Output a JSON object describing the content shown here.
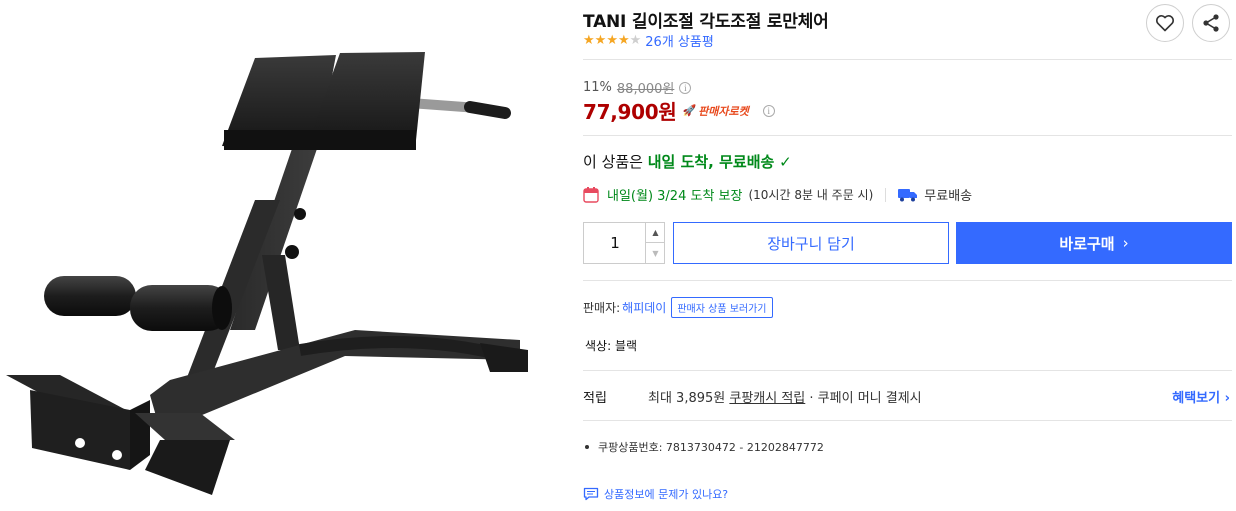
{
  "product": {
    "title": "TANI 길이조절 각도조절 로만체어",
    "rating_stars": 4,
    "rating_max": 5,
    "review_count": "26개 상품평"
  },
  "actions": {
    "wishlist_icon": "heart-outline-icon",
    "share_icon": "share-icon"
  },
  "price": {
    "discount_rate": "11%",
    "original_price": "88,000원",
    "sale_price": "77,900원",
    "badge": "판매자로켓"
  },
  "delivery": {
    "headline_prefix": "이 상품은 ",
    "headline_highlight": "내일 도착, 무료배송",
    "arrival": "내일(월) 3/24 도착 보장",
    "arrival_note": "(10시간 8분 내 주문 시)",
    "shipping": "무료배송"
  },
  "purchase": {
    "quantity": "1",
    "cart_label": "장바구니 담기",
    "buy_label": "바로구매"
  },
  "seller": {
    "label": "판매자:",
    "name": "해피데이",
    "link_label": "판매자 상품 보러가기"
  },
  "option": {
    "color_text": "색상: 블랙"
  },
  "reward": {
    "label": "적립",
    "prefix": "최대 3,895원 ",
    "link_text": "쿠팡캐시 적립",
    "suffix": " · 쿠페이 머니 결제시",
    "benefit_link": "혜택보기"
  },
  "details": {
    "product_number": "쿠팡상품번호: 7813730472 - 21202847772"
  },
  "report": {
    "text": "상품정보에 문제가 있나요?"
  },
  "colors": {
    "accent_blue": "#346aff",
    "price_red": "#ae0000",
    "delivery_green": "#00891a"
  }
}
